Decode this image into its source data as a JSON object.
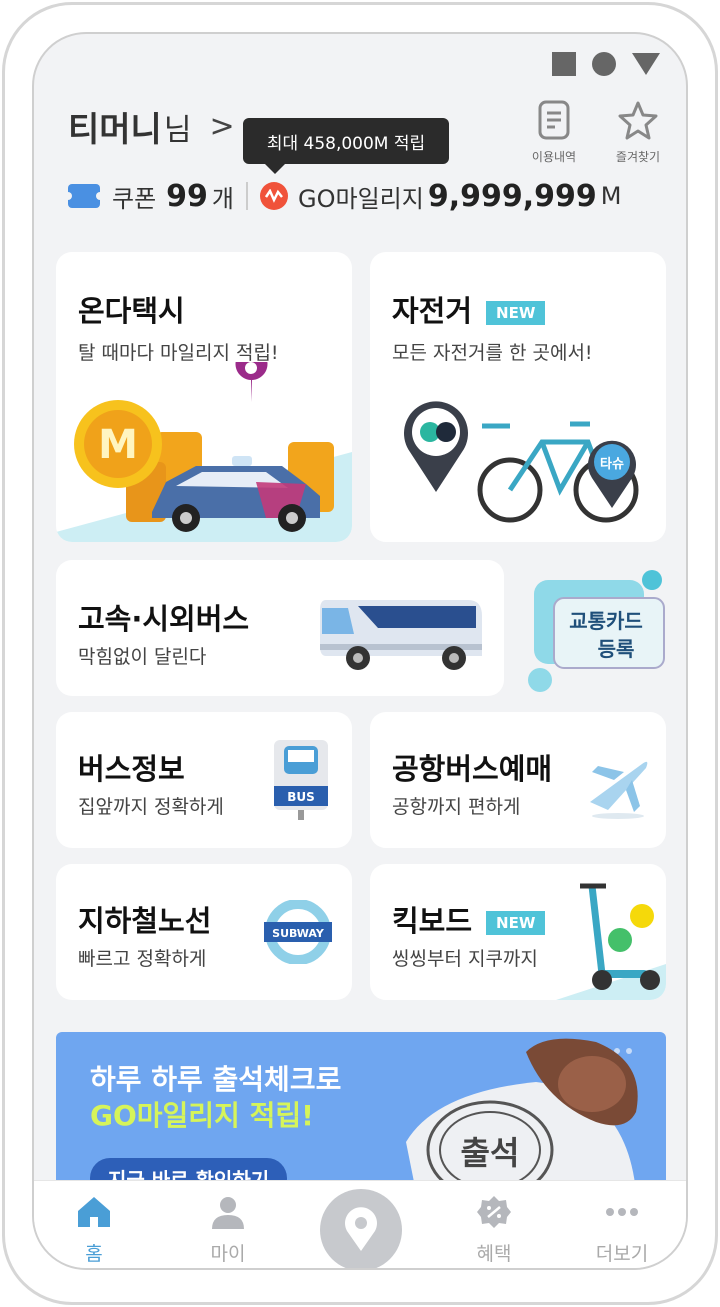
{
  "status_bar": {
    "icons": [
      "square-icon",
      "circle-icon",
      "triangle-icon"
    ]
  },
  "header": {
    "user_name": "티머니",
    "user_suffix": "님",
    "chevron": ">",
    "tooltip": "최대 458,000M 적립",
    "history_label": "이용내역",
    "favorites_label": "즐겨찾기"
  },
  "points": {
    "coupon_label": "쿠폰",
    "coupon_count": "99",
    "coupon_unit": "개",
    "mileage_label": "GO마일리지",
    "mileage_value": "9,999,999",
    "mileage_unit": "M"
  },
  "cards": {
    "taxi": {
      "title": "온다택시",
      "subtitle": "탈 때마다 마일리지 적립!",
      "coin_letter": "M"
    },
    "bike": {
      "title": "자전거",
      "badge": "NEW",
      "subtitle": "모든 자전거를 한 곳에서!",
      "pin_text": "타슈"
    },
    "express": {
      "title": "고속·시외버스",
      "subtitle": "막힘없이 달린다"
    },
    "transit_card": {
      "line1": "교통카드",
      "line2": "등록"
    },
    "bus": {
      "title": "버스정보",
      "subtitle": "집앞까지 정확하게",
      "sign_text": "BUS"
    },
    "airport": {
      "title": "공항버스예매",
      "subtitle": "공항까지 편하게"
    },
    "subway": {
      "title": "지하철노선",
      "subtitle": "빠르고 정확하게",
      "sign_text": "SUBWAY"
    },
    "kickboard": {
      "title": "킥보드",
      "badge": "NEW",
      "subtitle": "씽씽부터 지쿠까지"
    }
  },
  "banner": {
    "line1": "하루 하루 출석체크로",
    "line2": "GO마일리지 적립!",
    "button": "지금 바로 확인하기",
    "stamp_text": "출석"
  },
  "bottom_nav": {
    "home": "홈",
    "my": "마이",
    "benefit": "혜택",
    "more": "더보기"
  },
  "colors": {
    "accent": "#4a9ed6",
    "badge": "#4fc3d8",
    "banner_bg": "#6fa6f0",
    "banner_highlight": "#d6f45a"
  }
}
